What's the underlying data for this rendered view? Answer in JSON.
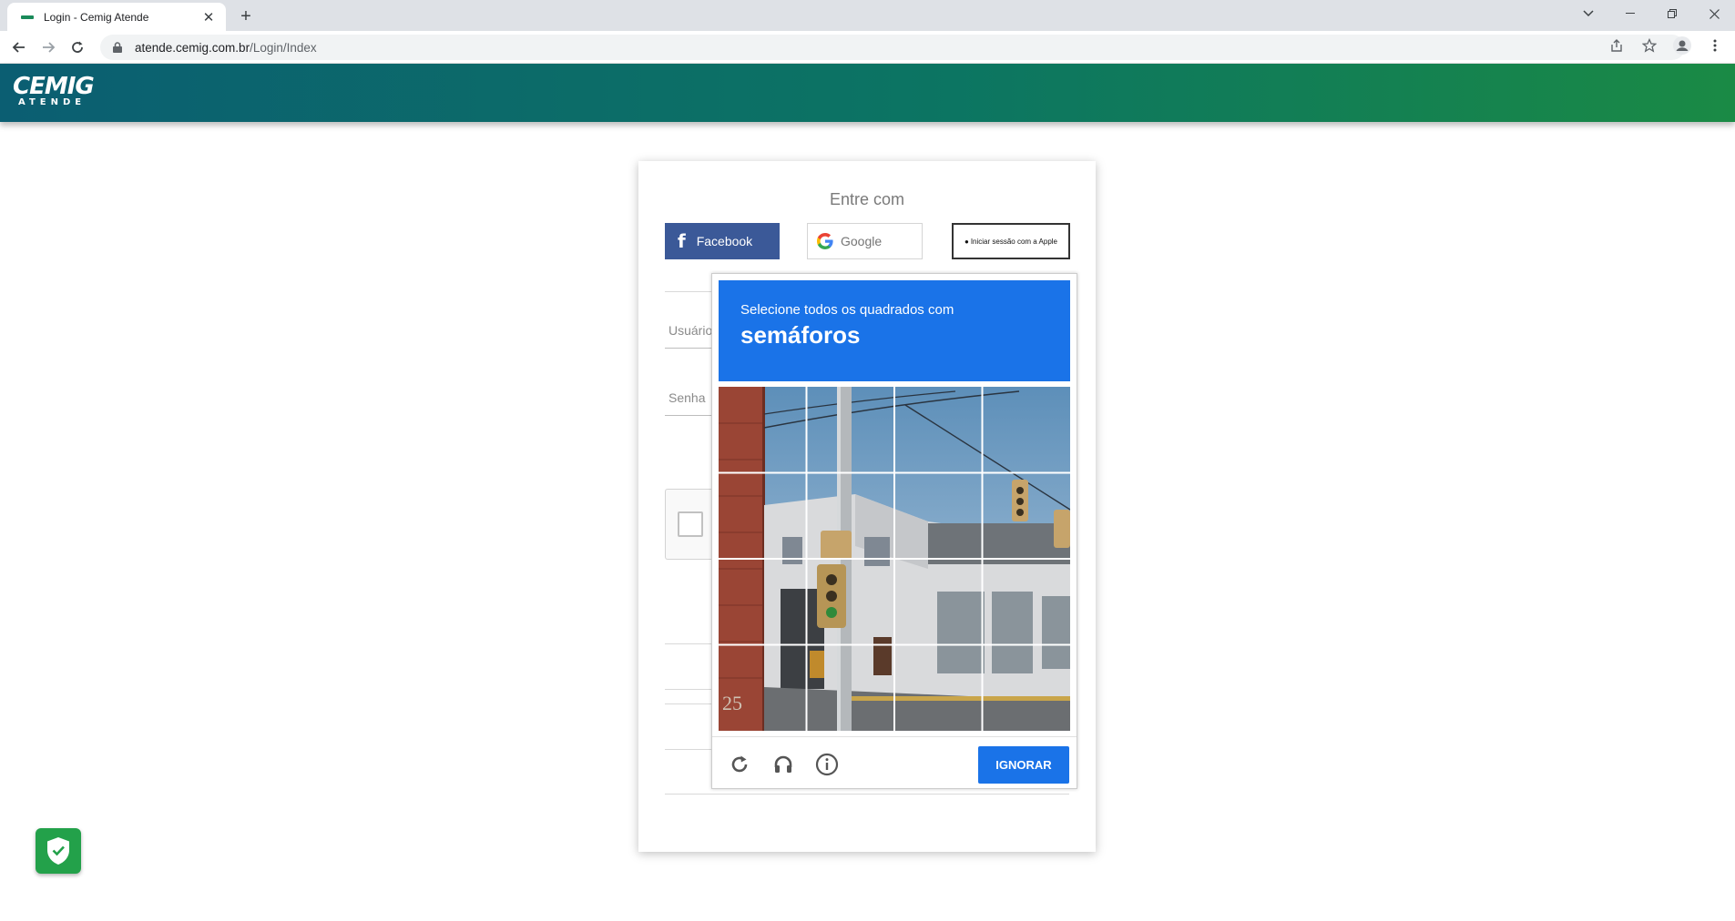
{
  "browser": {
    "tab_title": "Login - Cemig Atende",
    "url_domain": "atende.cemig.com.br",
    "url_path": "/Login/Index"
  },
  "site": {
    "logo_main": "CEMIG",
    "logo_sub": "ATENDE",
    "brand_color": "#0c7562"
  },
  "login": {
    "entre_com": "Entre com",
    "facebook_label": "Facebook",
    "google_label": "Google",
    "apple_label": "Iniciar sessão com a Apple",
    "usuario_label": "Usuário",
    "senha_label": "Senha"
  },
  "captcha": {
    "instruction": "Selecione todos os quadrados com",
    "target": "semáforos",
    "skip_label": "IGNORAR",
    "accent": "#1a73e8",
    "grid_rows": 4,
    "grid_cols": 4,
    "icons": [
      "reload-icon",
      "audio-icon",
      "info-icon"
    ]
  }
}
